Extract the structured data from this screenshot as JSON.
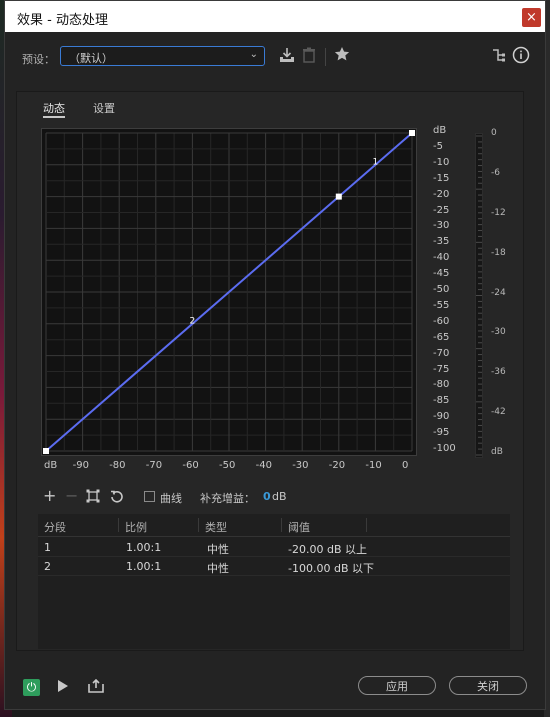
{
  "window": {
    "title": "效果 - 动态处理",
    "close_glyph": "×"
  },
  "preset": {
    "label": "预设：",
    "value": "（默认）"
  },
  "tabs": [
    {
      "label": "动态"
    },
    {
      "label": "设置"
    }
  ],
  "graph": {
    "y_unit_label": "dB",
    "y_ticks": [
      "0",
      "-5",
      "-10",
      "-15",
      "-20",
      "-25",
      "-30",
      "-35",
      "-40",
      "-45",
      "-50",
      "-55",
      "-60",
      "-65",
      "-70",
      "-75",
      "-80",
      "-85",
      "-90",
      "-95",
      "-100"
    ],
    "x_ticks": [
      "dB",
      "-90",
      "-80",
      "-70",
      "-60",
      "-50",
      "-40",
      "-30",
      "-20",
      "-10",
      "0"
    ],
    "points": [
      {
        "label": "",
        "x": -100,
        "y": -100
      },
      {
        "label": "",
        "x": -20,
        "y": -20
      },
      {
        "label": "",
        "x": 0,
        "y": 0
      }
    ],
    "segment_labels": [
      {
        "text": "1",
        "x": -10,
        "y": -9
      },
      {
        "text": "2",
        "x": -60,
        "y": -59
      }
    ],
    "line_color": "#5b6cf0",
    "x_range": [
      -100,
      0
    ],
    "y_range": [
      -100,
      0
    ]
  },
  "meter": {
    "ticks": [
      "0",
      "-6",
      "-12",
      "-18",
      "-24",
      "-30",
      "-36",
      "-42",
      "dB"
    ]
  },
  "controls": {
    "curve_label": "曲线",
    "makeup_label": "补充增益：",
    "makeup_value": "0",
    "makeup_unit": "dB",
    "accent": "#3a9ad9"
  },
  "table": {
    "headers": [
      "分段",
      "比例",
      "类型",
      "阈值"
    ],
    "rows": [
      [
        "1",
        "1.00:1",
        "中性",
        "-20.00 dB 以上"
      ],
      [
        "2",
        "1.00:1",
        "中性",
        "-100.00 dB 以下"
      ]
    ]
  },
  "footer": {
    "apply": "应用",
    "close": "关闭",
    "power_color": "#2e9d5c"
  }
}
